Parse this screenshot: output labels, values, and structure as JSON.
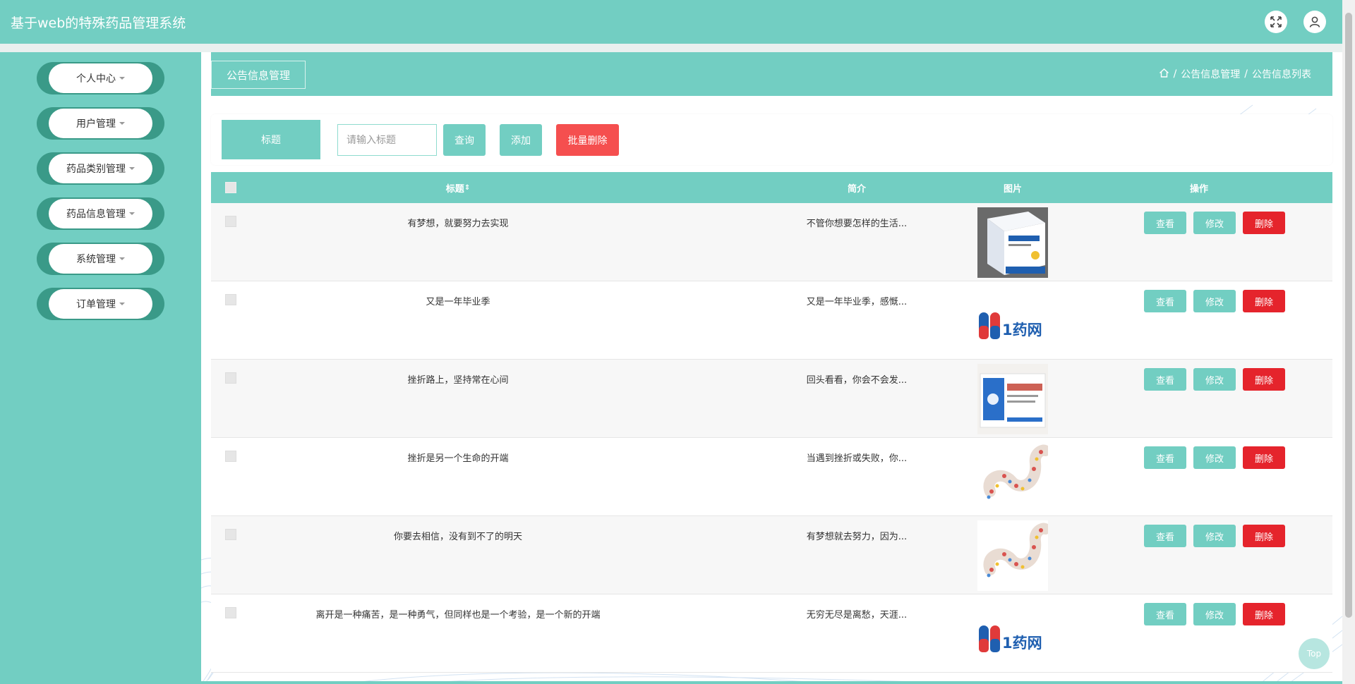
{
  "app": {
    "title": "基于web的特殊药品管理系统"
  },
  "topbar": {
    "fullscreen_icon": "fullscreen-icon",
    "user_icon": "user-icon"
  },
  "sidebar": {
    "items": [
      {
        "label": "个人中心"
      },
      {
        "label": "用户管理"
      },
      {
        "label": "药品类别管理"
      },
      {
        "label": "药品信息管理"
      },
      {
        "label": "系统管理"
      },
      {
        "label": "订单管理"
      }
    ]
  },
  "breadcrumb": {
    "tab": "公告信息管理",
    "path": [
      "公告信息管理",
      "公告信息列表"
    ]
  },
  "search": {
    "label": "标题",
    "placeholder": "请输入标题",
    "query_label": "查询",
    "add_label": "添加",
    "batch_delete_label": "批量删除"
  },
  "table": {
    "headers": {
      "title": "标题",
      "sort_icon": "⇕",
      "summary": "简介",
      "image": "图片",
      "actions": "操作"
    },
    "rows": [
      {
        "title": "有梦想，就要努力去实现",
        "summary": "不管你想要怎样的生活...",
        "image": "medicine-box-blue"
      },
      {
        "title": "又是一年毕业季",
        "summary": "又是一年毕业季，感慨...",
        "image": "1yao-logo"
      },
      {
        "title": "挫折路上，坚持常在心间",
        "summary": "回头看看，你会不会发...",
        "image": "medicine-box-tablets"
      },
      {
        "title": "挫折是另一个生命的开端",
        "summary": "当遇到挫折或失败，你...",
        "image": "pill-swirl"
      },
      {
        "title": "你要去相信，没有到不了的明天",
        "summary": "有梦想就去努力，因为...",
        "image": "pill-swirl"
      },
      {
        "title": "离开是一种痛苦，是一种勇气，但同样也是一个考验，是一个新的开端",
        "summary": "无穷无尽是离愁，天涯...",
        "image": "1yao-logo"
      }
    ],
    "actions": {
      "view": "查看",
      "edit": "修改",
      "delete": "删除"
    },
    "logo_text": "1药网"
  },
  "misc": {
    "back_to_top": "Top"
  },
  "colors": {
    "primary": "#72cec2",
    "danger": "#f54f4f",
    "danger_dark": "#e5242c"
  }
}
